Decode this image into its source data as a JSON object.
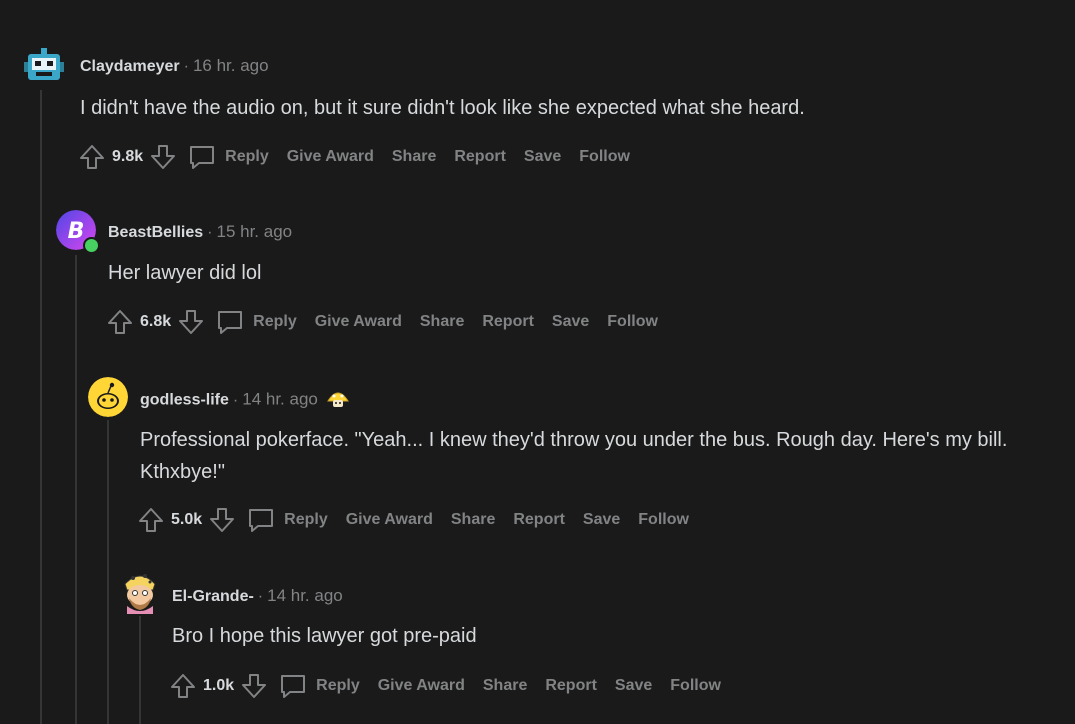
{
  "comments": [
    {
      "author": "Claydameyer",
      "separator": "·",
      "time": "16 hr. ago",
      "body": "I didn't have the audio on, but it sure didn't look like she expected what she heard.",
      "score": "9.8k",
      "actions": {
        "reply": "Reply",
        "award": "Give Award",
        "share": "Share",
        "report": "Report",
        "save": "Save",
        "follow": "Follow"
      }
    },
    {
      "author": "BeastBellies",
      "separator": "·",
      "time": "15 hr. ago",
      "body": "Her lawyer did lol",
      "score": "6.8k",
      "actions": {
        "reply": "Reply",
        "award": "Give Award",
        "share": "Share",
        "report": "Report",
        "save": "Save",
        "follow": "Follow"
      }
    },
    {
      "author": "godless-life",
      "separator": "·",
      "time": "14 hr. ago",
      "body": "Professional pokerface. \"Yeah... I knew they'd throw you under the bus. Rough day. Here's my bill. Kthxbye!\"",
      "score": "5.0k",
      "actions": {
        "reply": "Reply",
        "award": "Give Award",
        "share": "Share",
        "report": "Report",
        "save": "Save",
        "follow": "Follow"
      }
    },
    {
      "author": "El-Grande-",
      "separator": "·",
      "time": "14 hr. ago",
      "body": "Bro I hope this lawyer got pre-paid",
      "score": "1.0k",
      "actions": {
        "reply": "Reply",
        "award": "Give Award",
        "share": "Share",
        "report": "Report",
        "save": "Save",
        "follow": "Follow"
      }
    }
  ],
  "colors": {
    "background": "#1a1a1b",
    "text": "#d7dadc",
    "muted": "#818384",
    "thread_line": "#343536"
  },
  "icons": [
    "robot-avatar-icon",
    "letter-b-avatar-icon",
    "online-dot-icon",
    "snoo-avatar-icon",
    "mushroom-award-icon",
    "cartoon-avatar-icon",
    "upvote-icon",
    "downvote-icon",
    "comment-bubble-icon"
  ]
}
